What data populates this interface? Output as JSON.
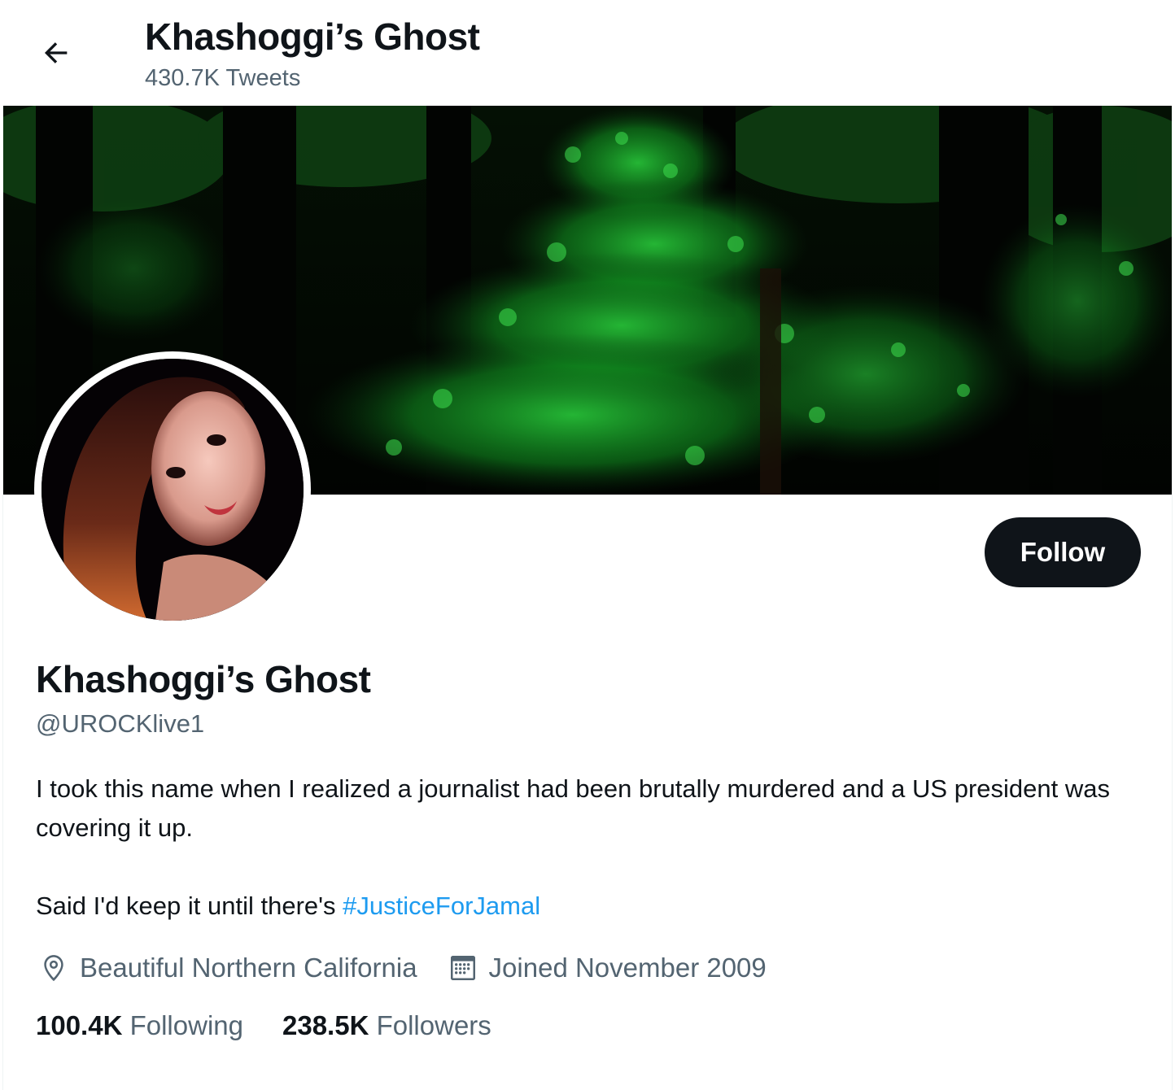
{
  "header": {
    "title": "Khashoggi’s Ghost",
    "tweet_count": "430.7K Tweets"
  },
  "icons": {
    "back": "arrow-left-icon",
    "location": "location-pin-icon",
    "joined": "calendar-icon"
  },
  "colors": {
    "text_primary": "#0f1419",
    "text_secondary": "#536471",
    "link": "#1d9bf0",
    "follow_button_bg": "#0f1419",
    "follow_button_text": "#ffffff",
    "banner_foliage": "#1fbf2f"
  },
  "profile": {
    "display_name": "Khashoggi’s Ghost",
    "handle": "@UROCKlive1",
    "follow_label": "Follow",
    "bio_line1": "I took this name when I realized a journalist had been brutally murdered and a US president was covering it up.",
    "bio_line2_prefix": "Said I'd keep it until there's ",
    "bio_hashtag": "#JusticeForJamal",
    "location": "Beautiful Northern California",
    "joined": "Joined November 2009",
    "following_count": "100.4K",
    "following_label": "Following",
    "followers_count": "238.5K",
    "followers_label": "Followers"
  }
}
